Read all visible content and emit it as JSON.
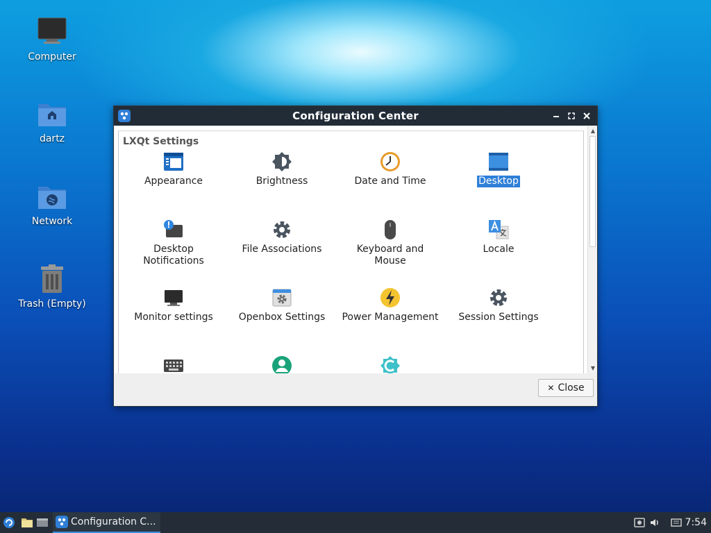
{
  "desktop": {
    "icons": [
      {
        "label": "Computer"
      },
      {
        "label": "dartz"
      },
      {
        "label": "Network"
      },
      {
        "label": "Trash (Empty)"
      }
    ]
  },
  "window": {
    "title": "Configuration Center",
    "section_title": "LXQt Settings",
    "items": [
      {
        "label": "Appearance",
        "icon": "appearance-icon"
      },
      {
        "label": "Brightness",
        "icon": "brightness-icon"
      },
      {
        "label": "Date and Time",
        "icon": "clock-icon"
      },
      {
        "label": "Desktop",
        "icon": "desktop-icon",
        "selected": true
      },
      {
        "label": "Desktop\nNotifications",
        "icon": "notification-icon"
      },
      {
        "label": "File Associations",
        "icon": "gear-icon"
      },
      {
        "label": "Keyboard and\nMouse",
        "icon": "mouse-icon"
      },
      {
        "label": "Locale",
        "icon": "locale-icon"
      },
      {
        "label": "Monitor settings",
        "icon": "monitor-icon"
      },
      {
        "label": "Openbox Settings",
        "icon": "openbox-icon"
      },
      {
        "label": "Power Management",
        "icon": "power-icon"
      },
      {
        "label": "Session Settings",
        "icon": "gear-icon"
      }
    ],
    "close_label": "Close",
    "close_glyph": "✕"
  },
  "taskbar": {
    "task_label": "Configuration C...",
    "clock": "7:54"
  },
  "colors": {
    "selection": "#2f7fd8",
    "titlebar": "#222c36",
    "taskbar": "#242d37"
  }
}
